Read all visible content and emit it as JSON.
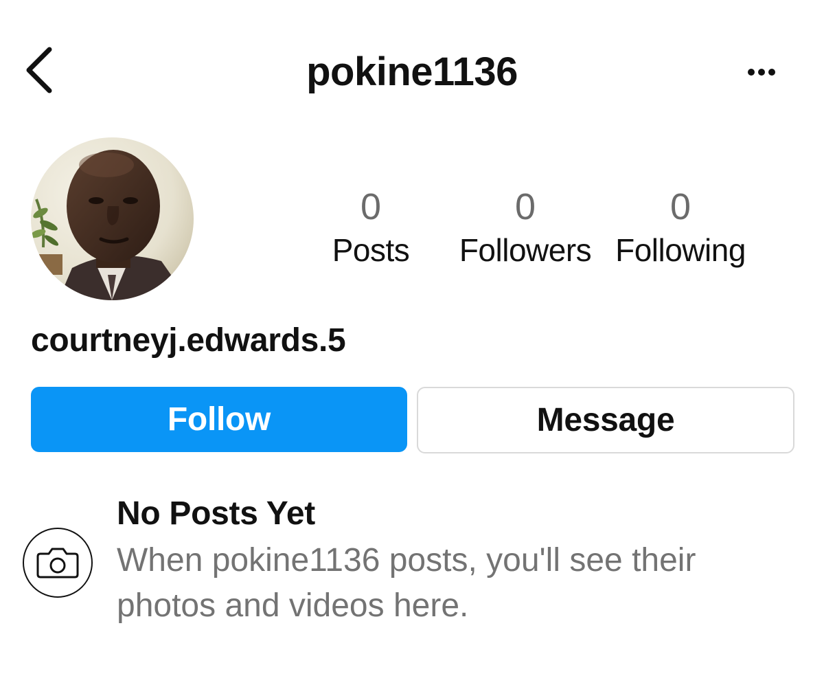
{
  "header": {
    "title": "pokine1136",
    "back_icon": "chevron-left-icon",
    "more_icon": "more-horizontal-icon"
  },
  "profile": {
    "display_name": "courtneyj.edwards.5",
    "avatar_icon": "profile-photo",
    "stats": [
      {
        "value": "0",
        "label": "Posts"
      },
      {
        "value": "0",
        "label": "Followers"
      },
      {
        "value": "0",
        "label": "Following"
      }
    ]
  },
  "actions": {
    "follow_label": "Follow",
    "message_label": "Message"
  },
  "empty_state": {
    "icon": "camera-icon",
    "title": "No Posts Yet",
    "description": "When pokine1136 posts, you'll see their photos and videos here."
  },
  "colors": {
    "accent": "#0a95f6",
    "muted_text": "#737373",
    "border": "#d9d9d9"
  }
}
